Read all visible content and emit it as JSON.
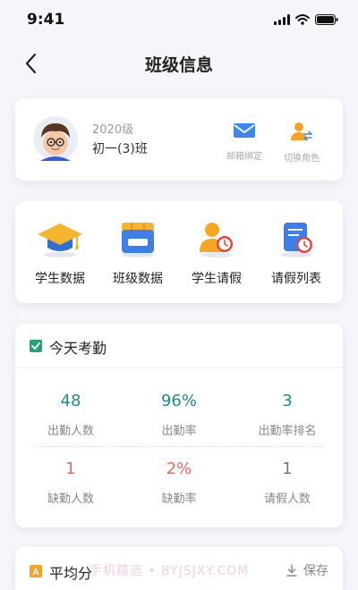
{
  "status_bar": {
    "time": "9:41"
  },
  "nav": {
    "title": "班级信息"
  },
  "profile": {
    "grade": "2020级",
    "class_name": "初一(3)班",
    "actions": [
      {
        "label": "邮箱绑定",
        "icon": "mail-icon"
      },
      {
        "label": "切换角色",
        "icon": "switch-role-icon"
      }
    ]
  },
  "shortcuts": [
    {
      "label": "学生数据",
      "icon": "graduation-cap-icon"
    },
    {
      "label": "班级数据",
      "icon": "class-box-icon"
    },
    {
      "label": "学生请假",
      "icon": "student-leave-icon"
    },
    {
      "label": "请假列表",
      "icon": "leave-list-icon"
    }
  ],
  "attendance": {
    "title": "今天考勤",
    "stats": [
      {
        "value": "48",
        "label": "出勤人数",
        "tone": "good"
      },
      {
        "value": "96%",
        "label": "出勤率",
        "tone": "good"
      },
      {
        "value": "3",
        "label": "出勤率排名",
        "tone": "good"
      },
      {
        "value": "1",
        "label": "缺勤人数",
        "tone": "bad"
      },
      {
        "value": "2%",
        "label": "缺勤率",
        "tone": "bad"
      },
      {
        "value": "1",
        "label": "请假人数",
        "tone": "neutral"
      }
    ]
  },
  "average": {
    "title": "平均分",
    "save_label": "保存"
  },
  "watermark": "手机精选 • BYJSJXY.COM",
  "colors": {
    "accent": "#1f8b86",
    "danger": "#e06b62",
    "blue": "#2d7ff0",
    "orange": "#f4a428"
  }
}
